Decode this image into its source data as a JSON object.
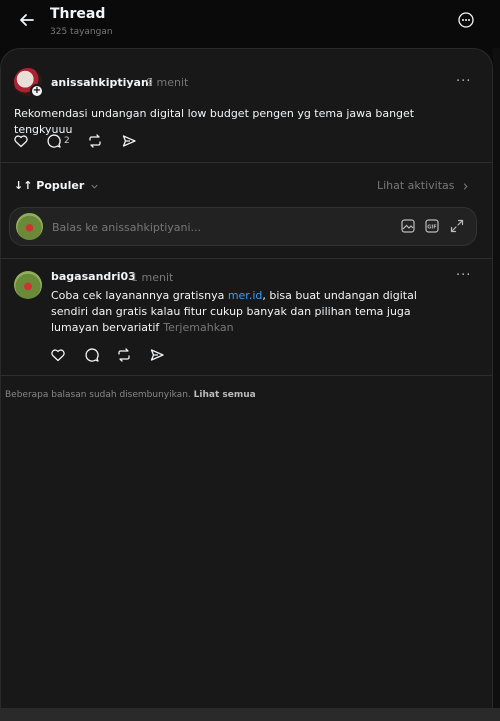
{
  "header": {
    "title": "Thread",
    "views": "325 tayangan"
  },
  "post": {
    "username": "anissahkiptiyani",
    "time": "9 menit",
    "text": "Rekomendasi undangan digital low budget pengen yg tema jawa banget tengkyuuu",
    "reply_count": "2",
    "more": "···"
  },
  "sort": {
    "label": "↓↑ Populer",
    "activity_link": "Lihat aktivitas"
  },
  "reply_box": {
    "placeholder": "Balas ke anissahkiptiyani..."
  },
  "comment": {
    "username": "bagasandri03",
    "time": "1 menit",
    "text_before_link": "Coba cek layanannya gratisnya ",
    "link": "mer.id",
    "text_after_link": ", bisa buat undangan digital sendiri dan gratis kalau fitur cukup banyak dan pilihan tema juga lumayan bervariatif",
    "translate": "Terjemahkan",
    "more": "···"
  },
  "hidden_note": {
    "text": "Beberapa balasan sudah disembunyikan.",
    "link": "Lihat semua"
  },
  "colors": {
    "background": "#0a0a0a",
    "panel": "#181818",
    "link": "#3b9cff"
  },
  "icons": [
    "back-arrow-icon",
    "more-circle-icon",
    "heart-icon",
    "comment-icon",
    "repost-icon",
    "share-icon",
    "chevron-down-icon",
    "chevron-right-icon",
    "image-icon",
    "gif-icon",
    "expand-icon"
  ]
}
